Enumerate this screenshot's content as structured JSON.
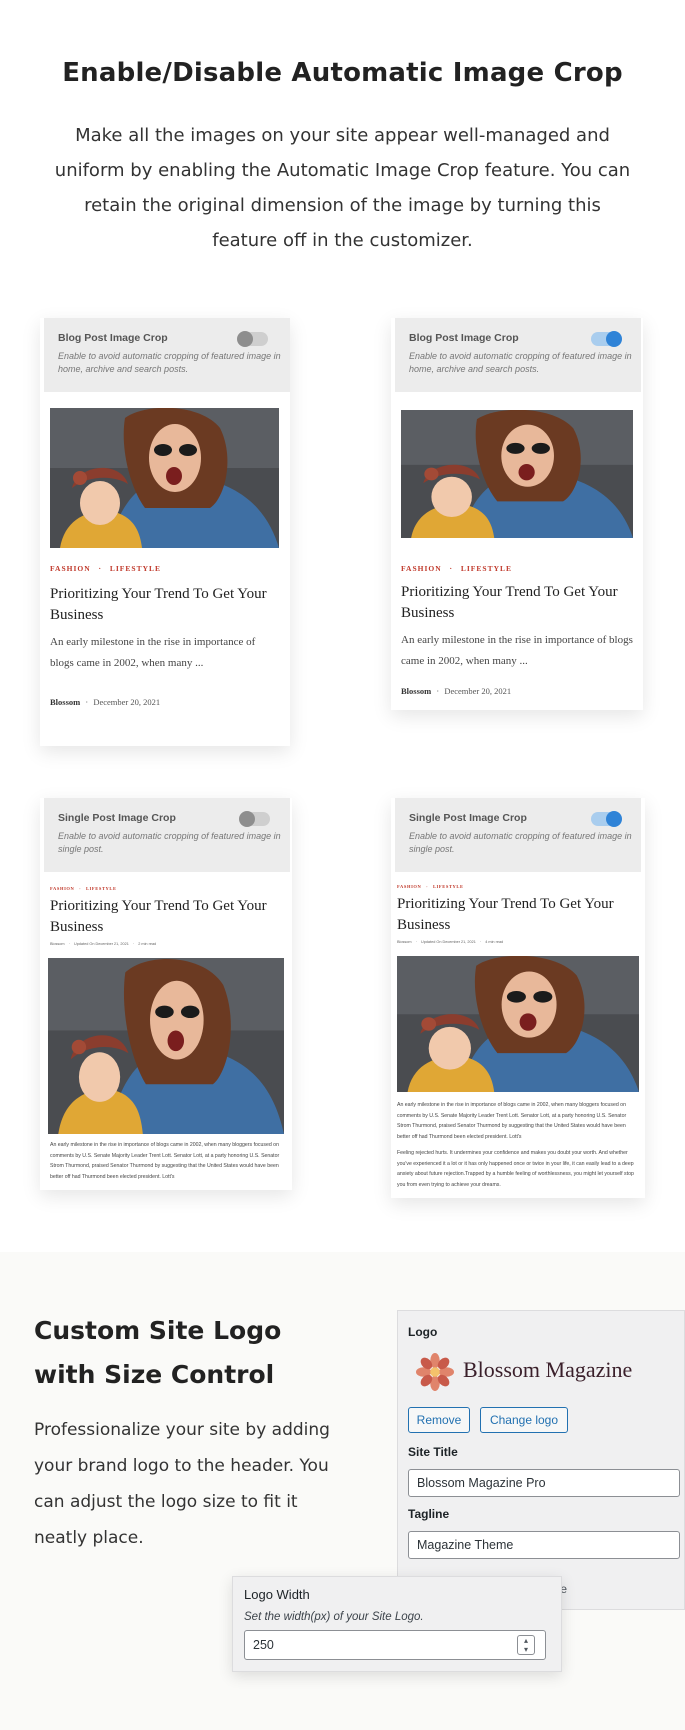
{
  "section1": {
    "heading": "Enable/Disable Automatic Image Crop",
    "intro": "Make all the images on your site appear well-managed and uniform by enabling the Automatic Image Crop feature. You can retain the original dimension of the image by turning this feature off in the customizer."
  },
  "blog_crop": {
    "title": "Blog Post Image Crop",
    "desc": "Enable to avoid automatic cropping of featured image in home, archive and search posts."
  },
  "single_crop": {
    "title": "Single Post Image Crop",
    "desc": "Enable to avoid automatic cropping of featured image in single post."
  },
  "post": {
    "cat1": "FASHION",
    "cat2": "LIFESTYLE",
    "title": "Prioritizing Your Trend To Get Your Business",
    "excerpt": "An early milestone in the rise in importance of blogs came in 2002, when many ...",
    "author": "Blossom",
    "date": "December 20, 2021",
    "updated_line": "Updated On December 21, 2021",
    "read_time_off": "2 min read",
    "read_time_on": "4 min read",
    "body_p1": "An early milestone in the rise in importance of blogs came in 2002, when many bloggers focused on comments by U.S. Senate Majority Leader Trent Lott. Senator Lott, at a party honoring U.S. Senator Strom Thurmond, praised Senator Thurmond by suggesting that the United States would have been better off had Thurmond been elected president. Lott's",
    "body_p2": "Feeling rejected hurts. It undermines your confidence and makes you doubt your worth. And whether you've experienced it a lot or it has only happened once or twice in your life, it can easily lead to a deep anxiety about future rejection.Trapped by a humble feeling of worthlessness, you might let yourself stop you from even trying to achieve your dreams."
  },
  "section2": {
    "heading": "Custom Site Logo with Size Control",
    "paragraph": "Professionalize your site by adding your brand logo to the header. You can adjust the logo size to fit it neatly place."
  },
  "logo_panel": {
    "logo_label": "Logo",
    "brand_name": "Blossom Magazine",
    "remove_btn": "Remove",
    "change_btn": "Change logo",
    "site_title_label": "Site Title",
    "site_title_value": "Blossom Magazine Pro",
    "tagline_label": "Tagline",
    "tagline_value": "Magazine Theme",
    "tail_text": "ine"
  },
  "width_panel": {
    "label": "Logo Width",
    "desc": "Set the width(px) of your Site Logo.",
    "value": "250"
  },
  "colors": {
    "accent_red": "#c0392b",
    "toggle_on": "#2f83d7",
    "wp_blue": "#2271b1"
  }
}
